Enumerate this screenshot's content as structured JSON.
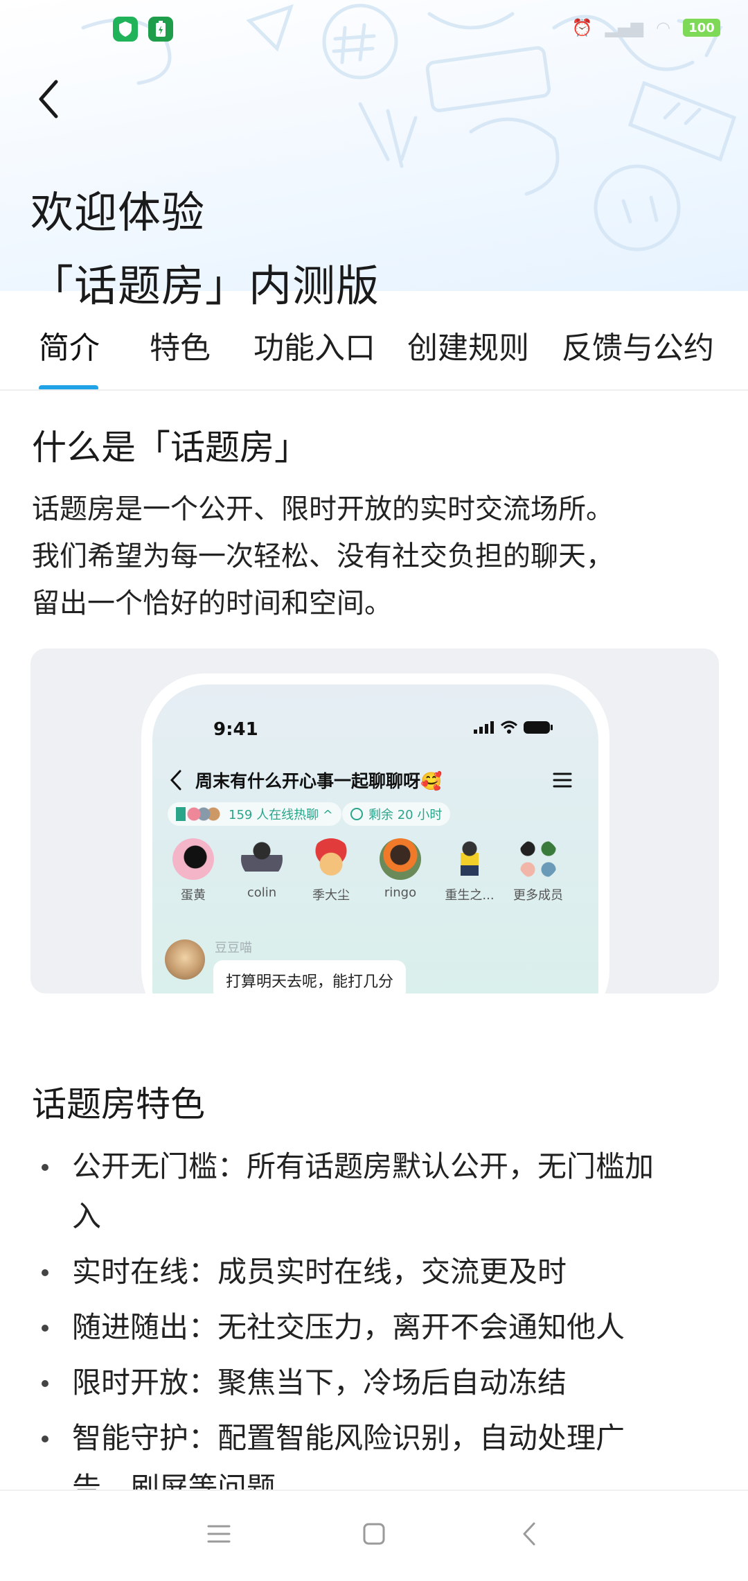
{
  "status_bar": {
    "battery": "100",
    "app_icons": [
      "shield-icon",
      "battery-saver-icon"
    ],
    "colors": {
      "app_icon_1": "#21b35a",
      "app_icon_2": "#1e9e4a"
    }
  },
  "header": {
    "back_icon": "chevron-left-icon",
    "title_line1": "欢迎体验",
    "title_line2": "「话题房」内测版"
  },
  "tabs": [
    {
      "label": "简介",
      "active": true
    },
    {
      "label": "特色",
      "active": false
    },
    {
      "label": "功能入口",
      "active": false
    },
    {
      "label": "创建规则",
      "active": false
    },
    {
      "label": "反馈与公约",
      "active": false
    }
  ],
  "accent_color": "#1fa3e6",
  "intro": {
    "title": "什么是「话题房」",
    "lines": [
      "话题房是一个公开、限时开放的实时交流场所。",
      "我们希望为每一次轻松、没有社交负担的聊天，",
      "留出一个恰好的时间和空间。"
    ]
  },
  "preview": {
    "time": "9:41",
    "room_title": "周末有什么开心事一起聊聊呀🥰",
    "online_pill": "159 人在线热聊 ^",
    "timer_pill": "剩余 20 小时",
    "members": [
      {
        "name": "蛋黄"
      },
      {
        "name": "colin"
      },
      {
        "name": "季大尘"
      },
      {
        "name": "ringo"
      },
      {
        "name": "重生之..."
      },
      {
        "name": "更多成员"
      }
    ],
    "message": {
      "sender": "豆豆喵",
      "text": "打算明天去呢，能打几分"
    }
  },
  "features": {
    "title": "话题房特色",
    "items": [
      {
        "line1": "公开无门槛：所有话题房默认公开，无门槛加",
        "line2": "入"
      },
      {
        "line1": "实时在线：成员实时在线，交流更及时",
        "line2": ""
      },
      {
        "line1": "随进随出：无社交压力，离开不会通知他人",
        "line2": ""
      },
      {
        "line1": "限时开放：聚焦当下，冷场后自动冻结",
        "line2": ""
      },
      {
        "line1": "智能守护：配置智能风险识别，自动处理广",
        "line2": "告、刷屏等问题"
      }
    ]
  },
  "nav_bar": {
    "icons": [
      "menu-icon",
      "home-square-icon",
      "back-arrow-icon"
    ]
  }
}
